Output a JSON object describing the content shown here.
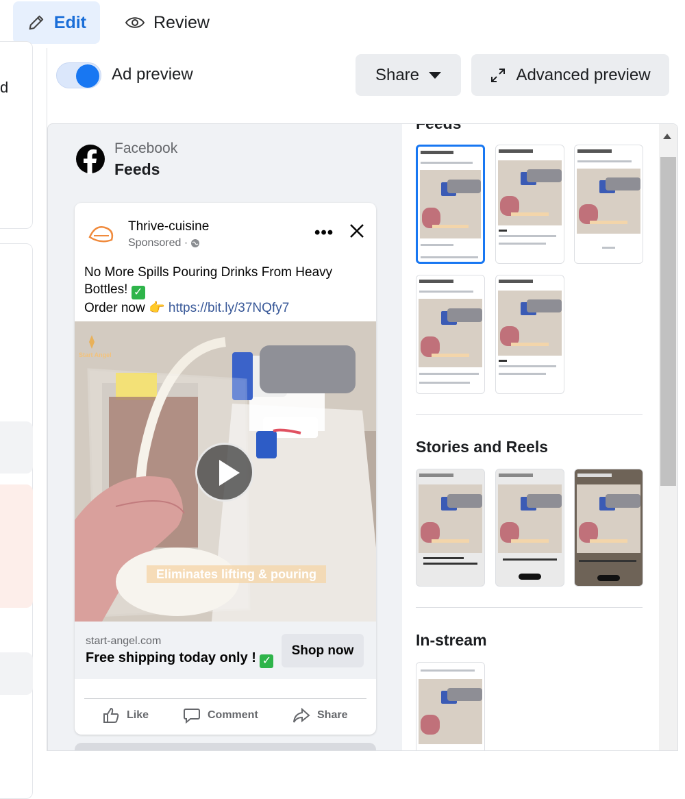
{
  "tabs": {
    "edit_label": "Edit",
    "review_label": "Review"
  },
  "left_panel": {
    "cut_text": "d"
  },
  "preview_header": {
    "toggle_label": "Ad preview",
    "toggle_on": true,
    "share_label": "Share",
    "advanced_preview_label": "Advanced preview"
  },
  "placement": {
    "platform": "Facebook",
    "placement_name": "Feeds"
  },
  "ad_post": {
    "page_name": "Thrive-cuisine",
    "sponsored": "Sponsored ·",
    "primary_text_line1": "No More Spills Pouring Drinks From Heavy Bottles!",
    "primary_text_line2": "Order now 👉",
    "link": "https://bit.ly/37NQfy7",
    "video_caption": "Eliminates lifting & pouring",
    "brand_watermark": "Start Angel",
    "domain": "start-angel.com",
    "headline": "Free shipping today only !",
    "cta_label": "Shop now",
    "actions": {
      "like": "Like",
      "comment": "Comment",
      "share": "Share"
    }
  },
  "placements_list": {
    "feeds_title": "Feeds",
    "stories_title": "Stories and Reels",
    "instream_title": "In-stream"
  },
  "colors": {
    "accent": "#1877f2",
    "edit_tab_bg": "#e7f0fd",
    "panel_bg": "#f0f2f5"
  }
}
